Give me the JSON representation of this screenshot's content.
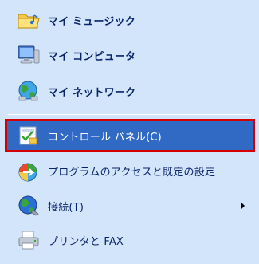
{
  "menu": {
    "items": [
      {
        "label": "マイ ミュージック",
        "icon": "music-folder-icon"
      },
      {
        "label": "マイ コンピュータ",
        "icon": "computer-icon"
      },
      {
        "label": "マイ ネットワーク",
        "icon": "network-globe-icon"
      },
      {
        "label": "コントロール パネル(C)",
        "icon": "control-panel-icon"
      },
      {
        "label": "プログラムのアクセスと既定の設定",
        "icon": "program-access-icon"
      },
      {
        "label": "接続(T)",
        "icon": "connect-globe-icon"
      },
      {
        "label": "プリンタと FAX",
        "icon": "printer-fax-icon"
      }
    ]
  },
  "colors": {
    "background": "#d3e5fa",
    "selected": "#316ac5",
    "highlight_frame": "#d40000",
    "text": "#0a246a"
  }
}
